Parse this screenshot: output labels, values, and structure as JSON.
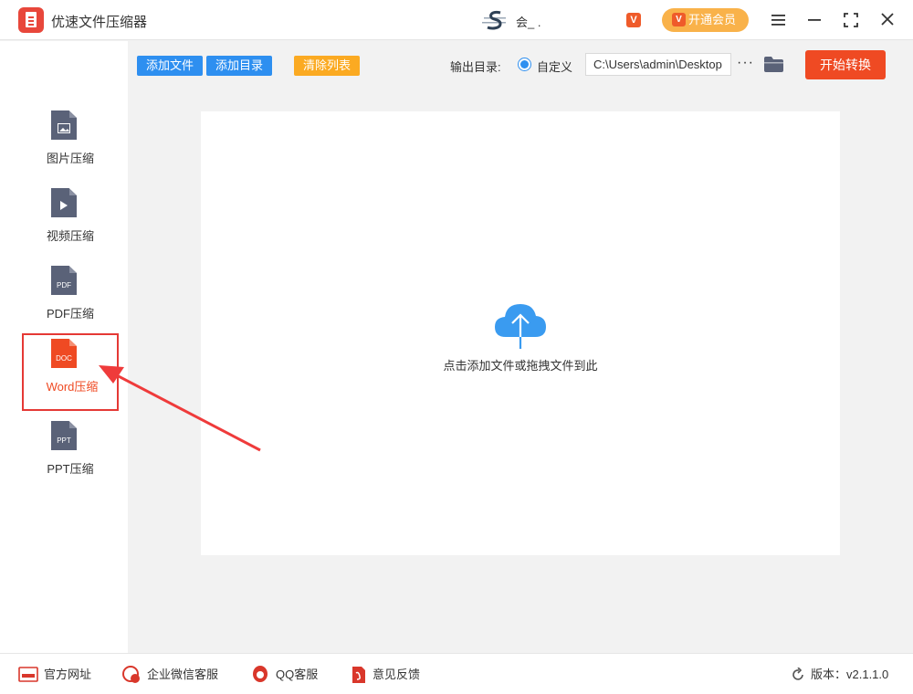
{
  "app": {
    "title": "优速文件压缩器",
    "logo_icon": "app-logo-icon"
  },
  "user": {
    "name": "会_ .",
    "vip_badge": "V",
    "vip_button": "开通会员"
  },
  "window_controls": [
    "menu-icon",
    "minimize-icon",
    "maximize-icon",
    "close-icon"
  ],
  "sidebar": {
    "items": [
      {
        "label": "图片压缩",
        "icon_text": "",
        "icon": "image-file-icon",
        "active": false
      },
      {
        "label": "视频压缩",
        "icon_text": "",
        "icon": "video-file-icon",
        "active": false
      },
      {
        "label": "PDF压缩",
        "icon_text": "PDF",
        "icon": "pdf-file-icon",
        "active": false
      },
      {
        "label": "Word压缩",
        "icon_text": "DOC",
        "icon": "doc-file-icon",
        "active": true
      },
      {
        "label": "PPT压缩",
        "icon_text": "PPT",
        "icon": "ppt-file-icon",
        "active": false
      }
    ]
  },
  "toolbar": {
    "add_file": "添加文件",
    "add_folder": "添加目录",
    "clear_list": "清除列表",
    "output_label": "输出目录:",
    "radio_label": "自定义",
    "output_path": "C:\\Users\\admin\\Desktop",
    "more": "···",
    "start": "开始转换"
  },
  "dropzone": {
    "text": "点击添加文件或拖拽文件到此",
    "icon": "cloud-upload-icon"
  },
  "footer": {
    "website": "官方网址",
    "wechat": "企业微信客服",
    "qq": "QQ客服",
    "feedback": "意见反馈",
    "version": "版本：v2.1.1.0"
  },
  "colors": {
    "accent": "#ef4a23",
    "blue": "#2e8ff0",
    "orange": "#fbaa22",
    "vip": "#f9b24a"
  }
}
